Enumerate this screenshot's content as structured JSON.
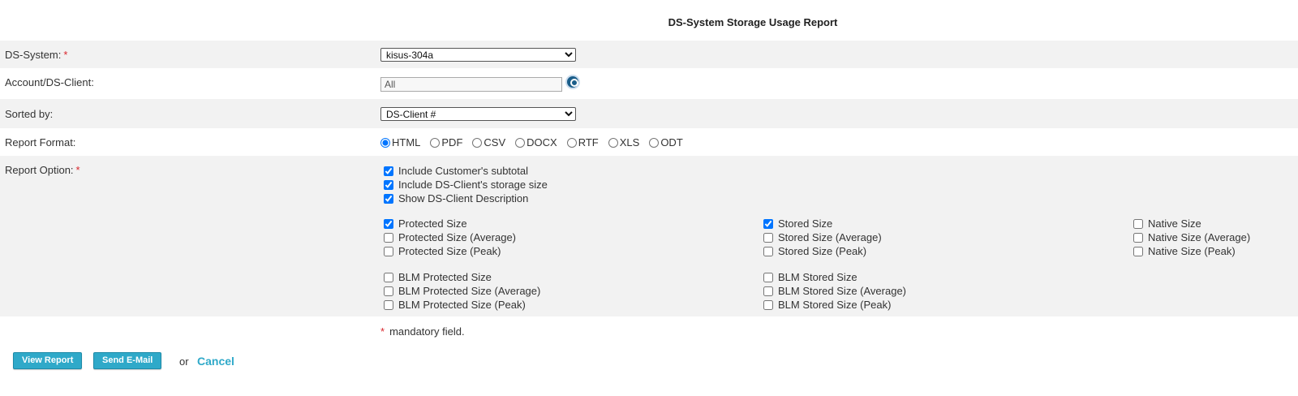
{
  "page_title": "DS-System Storage Usage Report",
  "ds_system": {
    "label": "DS-System:",
    "required_mark": "*",
    "value": "kisus-304a"
  },
  "account": {
    "label": "Account/DS-Client:",
    "value": "All"
  },
  "sorted_by": {
    "label": "Sorted by:",
    "value": "DS-Client #"
  },
  "report_format": {
    "label": "Report Format:",
    "options": [
      "HTML",
      "PDF",
      "CSV",
      "DOCX",
      "RTF",
      "XLS",
      "ODT"
    ],
    "selected": "HTML"
  },
  "report_option": {
    "label": "Report Option:",
    "required_mark": "*",
    "general": [
      {
        "label": "Include Customer's subtotal",
        "checked": true
      },
      {
        "label": "Include DS-Client's storage size",
        "checked": true
      },
      {
        "label": "Show DS-Client Description",
        "checked": true
      }
    ],
    "protected": [
      {
        "label": "Protected Size",
        "checked": true
      },
      {
        "label": "Protected Size (Average)",
        "checked": false
      },
      {
        "label": "Protected Size (Peak)",
        "checked": false
      }
    ],
    "stored": [
      {
        "label": "Stored Size",
        "checked": true
      },
      {
        "label": "Stored Size (Average)",
        "checked": false
      },
      {
        "label": "Stored Size (Peak)",
        "checked": false
      }
    ],
    "native": [
      {
        "label": "Native Size",
        "checked": false
      },
      {
        "label": "Native Size (Average)",
        "checked": false
      },
      {
        "label": "Native Size (Peak)",
        "checked": false
      }
    ],
    "blm_protected": [
      {
        "label": "BLM Protected Size",
        "checked": false
      },
      {
        "label": "BLM Protected Size (Average)",
        "checked": false
      },
      {
        "label": "BLM Protected Size (Peak)",
        "checked": false
      }
    ],
    "blm_stored": [
      {
        "label": "BLM Stored Size",
        "checked": false
      },
      {
        "label": "BLM Stored Size (Average)",
        "checked": false
      },
      {
        "label": "BLM Stored Size (Peak)",
        "checked": false
      }
    ]
  },
  "mandatory_note": {
    "mark": "*",
    "text": "mandatory field."
  },
  "actions": {
    "view_report": "View Report",
    "send_email": "Send E-Mail",
    "or": "or",
    "cancel": "Cancel"
  },
  "colors": {
    "accent": "#2fa9c9",
    "required": "#d9262c",
    "row_shade": "#f2f2f2"
  }
}
